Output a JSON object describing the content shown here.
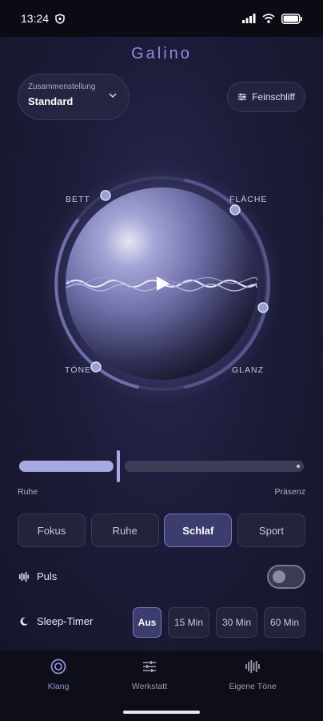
{
  "status": {
    "time": "13:24"
  },
  "app": {
    "brand": "Galino"
  },
  "preset": {
    "label": "Zusammenstellung",
    "value": "Standard"
  },
  "finetune": {
    "label": "Feinschliff"
  },
  "orb": {
    "labels": {
      "top_left": "BETT",
      "top_right": "FLÄCHE",
      "bottom_left": "TÖNE",
      "bottom_right": "GLANZ"
    }
  },
  "slider": {
    "left_label": "Ruhe",
    "right_label": "Präsenz",
    "value_fraction": 0.35
  },
  "modes": [
    {
      "label": "Fokus",
      "active": false
    },
    {
      "label": "Ruhe",
      "active": false
    },
    {
      "label": "Schlaf",
      "active": true
    },
    {
      "label": "Sport",
      "active": false
    }
  ],
  "pulse": {
    "label": "Puls",
    "enabled": false
  },
  "sleep_timer": {
    "label": "Sleep-Timer",
    "options": [
      {
        "label": "Aus",
        "active": true
      },
      {
        "label": "15 Min",
        "active": false
      },
      {
        "label": "30 Min",
        "active": false
      },
      {
        "label": "60 Min",
        "active": false
      }
    ]
  },
  "nav": [
    {
      "label": "Klang",
      "icon": "target-icon",
      "active": true
    },
    {
      "label": "Werkstatt",
      "icon": "sliders-icon",
      "active": false
    },
    {
      "label": "Eigene Töne",
      "icon": "waveform-icon",
      "active": false
    }
  ],
  "colors": {
    "accent": "#8e8edc",
    "active_bg": "#3c3c6e",
    "background": "#14142a"
  }
}
